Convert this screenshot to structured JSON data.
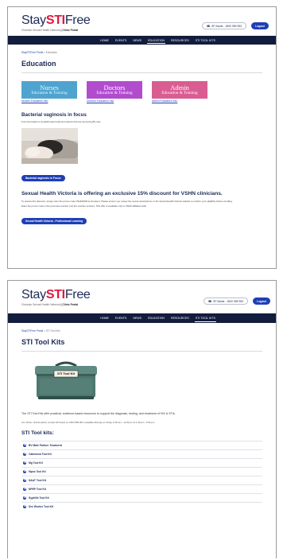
{
  "header": {
    "logo_prefix": "Stay",
    "logo_accent": "STI",
    "logo_suffix": "Free",
    "logo_subtitle_prefix": "Victorian Sexual Health Network",
    "logo_subtitle_bold": "| Clinic Portal",
    "phone_label": "SP Assist - 1800 089 953",
    "logout_label": "Logout"
  },
  "nav": {
    "items": [
      "HOME",
      "EVENTS",
      "NEWS",
      "EDUCATION",
      "RESOURCES",
      "STI TOOL KITS"
    ]
  },
  "education_page": {
    "breadcrumb_home": "StaySTIFree Portal",
    "breadcrumb_sep": ">",
    "breadcrumb_current": "Education",
    "title": "Education",
    "tiles": [
      {
        "line1": "Nurses",
        "line2": "Education & Training",
        "link": "Nurses Education Info"
      },
      {
        "line1": "Doctors",
        "line2": "Education & Training",
        "link": "Doctors Education Info"
      },
      {
        "line1": "Admin",
        "line2": "Education & Training",
        "link": "Admin Education Info"
      }
    ],
    "bv_title": "Bacterial vaginosis in focus",
    "bv_text": "From the basics to breakthrough treatment options that are improving BV care",
    "bv_button": "Bacterial vaginosis in Focus",
    "offer_title": "Sexual Health Victoria is offering an exclusive 15% discount for VSHN clinicians.",
    "offer_text_1": "To access this discount, simply enter the promo code VSHN2025 at checkout. Please ensure you review the course descriptions on the Sexual Health Victoria website to confirm your eligibility before enrolling.",
    "offer_text_2": "Enter the promo code in the promotion section (not the voucher section). This offer is available only to VSHN affiliated staff.",
    "offer_button": "Sexual Health Victoria - Professional Learning"
  },
  "toolkits_page": {
    "breadcrumb_home": "StaySTIFree Portal",
    "breadcrumb_sep": ">",
    "breadcrumb_current": "STI Tool Kits",
    "title": "STI Tool Kits",
    "box_label": "STI Tool Kit",
    "lead": "The STI Tool Kits offer practical, evidence-based resources to support the diagnosis, testing, and treatment of HIV & STIs.",
    "advice": "For further clinical advice contact SP Assist on 1800 089 953. Available Monday to Friday, 8:30 am - 12:30 pm & 1:30 pm - 5:00 pm",
    "list_title": "STI Tool kits:",
    "kits": [
      "BV Male Partner Treatment",
      "Cabenuva Tool Kit",
      "Mg Tool Kit",
      "Mpox Tool Kit",
      "NAAT Tool Kit",
      "NPEP Tool Kit",
      "Syphilis Tool Kit",
      "Sex Worker Tool Kit"
    ]
  },
  "colors": {
    "navy": "#121d3e",
    "brand_blue": "#1f3fb5",
    "accent_red": "#e4173d",
    "tile_nurses": "#4fa4cf",
    "tile_doctors": "#b24ccf",
    "tile_admin": "#da5d92"
  }
}
